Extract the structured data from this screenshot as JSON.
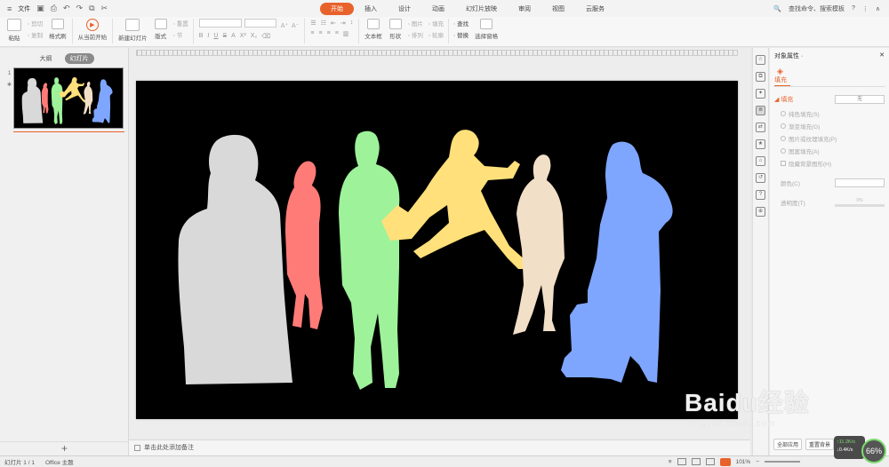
{
  "menubar": {
    "file_label": "文件",
    "tabs": [
      {
        "label": "开始",
        "active": true
      },
      {
        "label": "插入",
        "active": false
      },
      {
        "label": "设计",
        "active": false
      },
      {
        "label": "动画",
        "active": false
      },
      {
        "label": "幻灯片放映",
        "active": false
      },
      {
        "label": "审阅",
        "active": false
      },
      {
        "label": "视图",
        "active": false
      },
      {
        "label": "云服务",
        "active": false
      }
    ],
    "search_text": "查找命令、搜索模板",
    "help": "?",
    "colors": {
      "accent": "#e8622c"
    }
  },
  "ribbon": {
    "paste": "粘贴",
    "cut": "剪切",
    "copy": "复制",
    "format_painter": "格式刷",
    "from_current": "从当前开始",
    "new_slide": "新建幻灯片",
    "layout": "版式",
    "reset": "重置",
    "section": "节",
    "font_size_up": "A⁺",
    "font_size_down": "A⁻",
    "text_box": "文本框",
    "shape": "形状",
    "arrange": "排列",
    "picture": "图片",
    "fill": "填充",
    "outline": "轮廓",
    "find": "查找",
    "replace": "替换",
    "select_pane": "选择窗格"
  },
  "left_panel": {
    "tab_outline": "大纲",
    "tab_slides": "幻灯片",
    "thumb_number": "1",
    "add_label": "+"
  },
  "notes": {
    "placeholder": "单击此处添加备注"
  },
  "props": {
    "title": "对象属性 ·",
    "tab_fill": "填充",
    "section_fill": "◢ 填充",
    "fill_value": "无",
    "options": [
      "纯色填充(S)",
      "渐变填充(G)",
      "图片或纹理填充(P)",
      "图案填充(A)"
    ],
    "hide_bg": "隐藏背景图形(H)",
    "color_label": "颜色(C)",
    "transparency_label": "透明度(T)",
    "transparency_value": "0%"
  },
  "statusbar": {
    "slide_info": "幻灯片 1 / 1",
    "theme": "Office 主题",
    "zoom": "101%"
  },
  "overlays": {
    "btn_full": "全部应用",
    "btn_reset": "重置背景",
    "up_speed": "↑11.2K/s",
    "down_speed": "↓0.4K/s",
    "gauge": "66%"
  },
  "watermark": {
    "main": "Baidu经验",
    "url": "jingyan.baidu.com"
  },
  "slide": {
    "figure_colors": [
      "#d9d9d9",
      "#ff7b78",
      "#9ef29a",
      "#ffe07a",
      "#f2dfc8",
      "#7ea6ff"
    ]
  }
}
